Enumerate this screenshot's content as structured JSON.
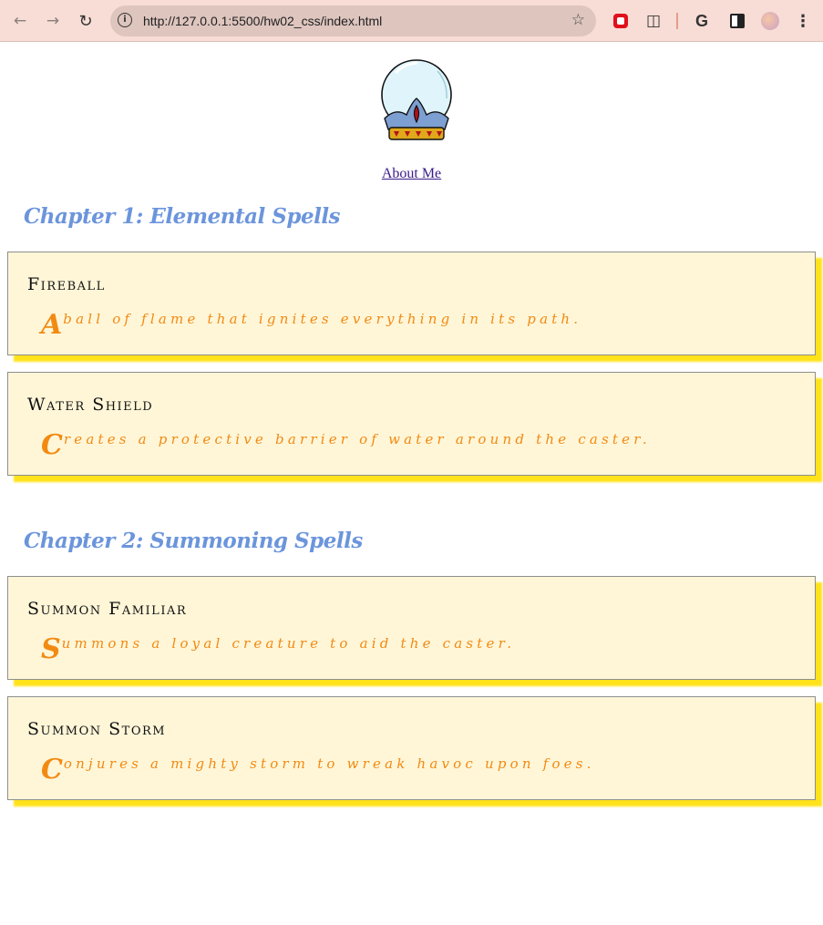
{
  "browser": {
    "url": "http://127.0.0.1:5500/hw02_css/index.html",
    "back_icon": "arrow-left-icon",
    "forward_icon": "arrow-right-icon",
    "reload_icon": "reload-icon"
  },
  "nav": {
    "about_label": "About Me"
  },
  "chapters": [
    {
      "title": "Chapter 1: Elemental Spells",
      "spells": [
        {
          "name": "Fireball",
          "initial": "A",
          "text": "ball of flame that ignites everything in its path."
        },
        {
          "name": "Water Shield",
          "initial": "C",
          "text": "reates a protective barrier of water around the caster."
        }
      ]
    },
    {
      "title": "Chapter 2: Summoning Spells",
      "spells": [
        {
          "name": "Summon Familiar",
          "initial": "S",
          "text": "ummons a loyal creature to aid the caster."
        },
        {
          "name": "Summon Storm",
          "initial": "C",
          "text": "onjures a mighty storm to wreak havoc upon foes."
        }
      ]
    }
  ],
  "colors": {
    "chapter_title": "#6b95dc",
    "card_background": "#fff6d8",
    "card_shadow": "#ffe21a",
    "spell_text": "#f28a12",
    "chrome": "#f7ddd6"
  }
}
